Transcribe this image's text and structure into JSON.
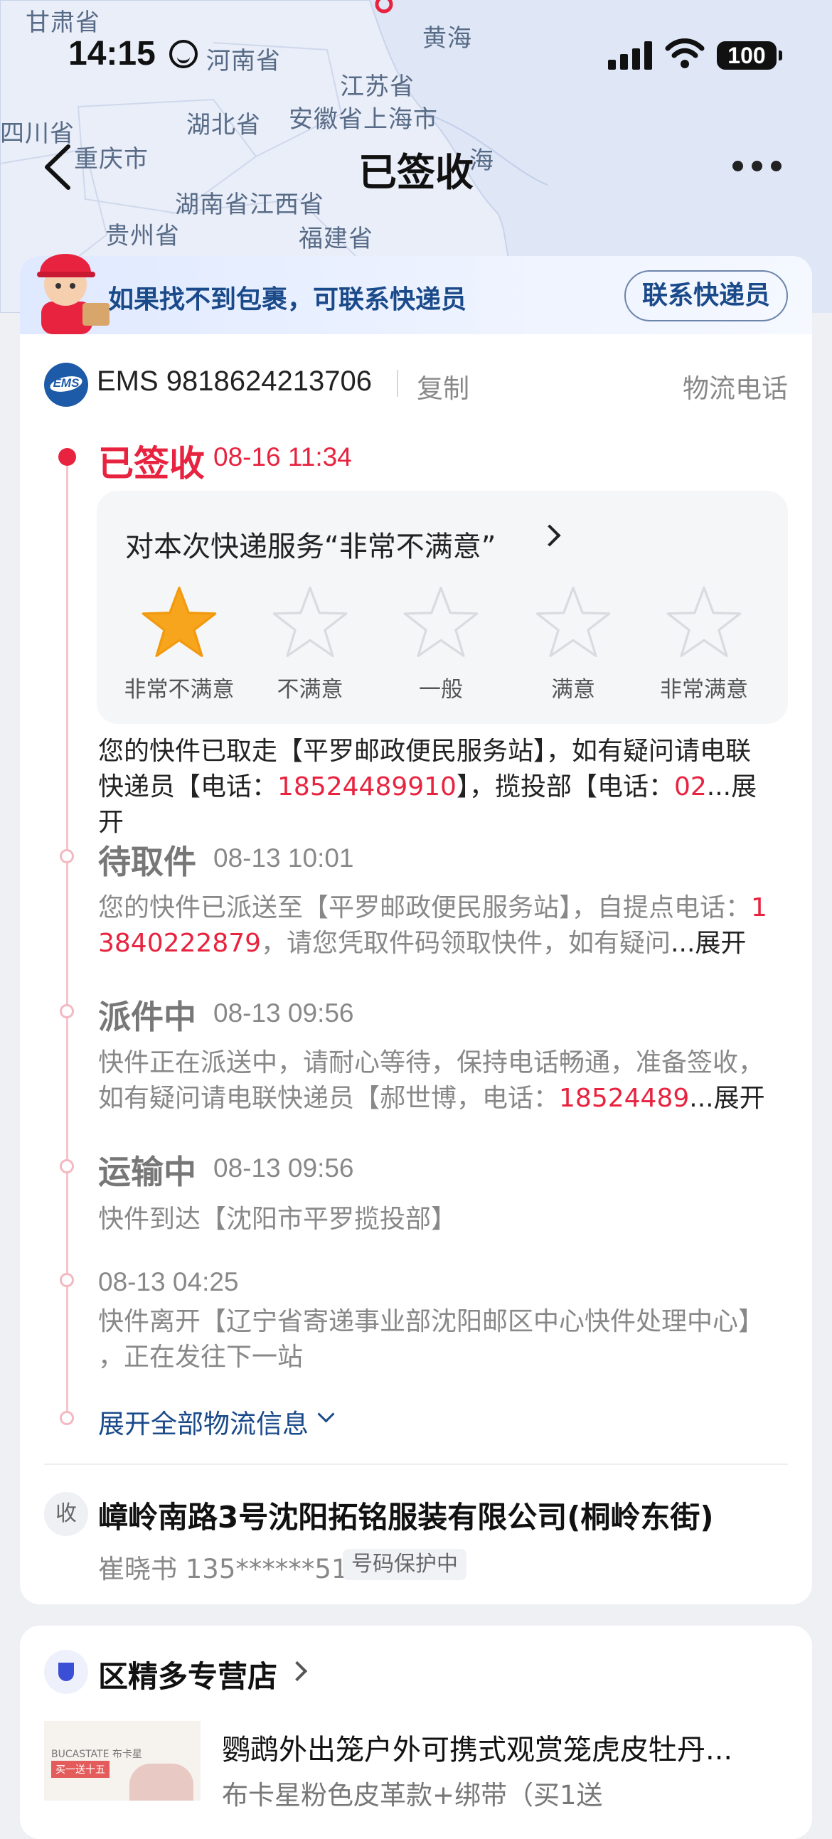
{
  "status_bar": {
    "time": "14:15",
    "battery": "100"
  },
  "map": {
    "labels": [
      {
        "text": "甘肃省"
      },
      {
        "text": "河南省"
      },
      {
        "text": "黄海"
      },
      {
        "text": "江苏省"
      },
      {
        "text": "四川省"
      },
      {
        "text": "湖北省"
      },
      {
        "text": "安徽省上海市"
      },
      {
        "text": "重庆市"
      },
      {
        "text": "海"
      },
      {
        "text": "湖南省江西省"
      },
      {
        "text": "贵州省"
      },
      {
        "text": "福建省"
      }
    ]
  },
  "nav": {
    "title": "已签收"
  },
  "banner": {
    "text": "如果找不到包裹，可联系快递员",
    "button": "联系快递员"
  },
  "shipment": {
    "carrier_logo": "EMS",
    "tracking": "EMS 9818624213706",
    "copy": "复制",
    "phone": "物流电话"
  },
  "timeline": {
    "current": {
      "status": "已签收",
      "time": "08-16 11:34",
      "desc_1": "您的快件已取走【平罗邮政便民服务站】，如有疑问请电联",
      "desc_2a": "快递员【电话：",
      "desc_2_phone": "18524489910",
      "desc_2b": "】，揽投部【电话：",
      "desc_2_phone2": "02",
      "desc_2_more": "...展开"
    },
    "rating": {
      "title": "对本次快递服务“非常不满意”",
      "options": [
        "非常不满意",
        "不满意",
        "一般",
        "满意",
        "非常满意"
      ],
      "selected": 1,
      "star_color": "#f7a51c"
    },
    "events": [
      {
        "status": "待取件",
        "time": "08-13 10:01",
        "line1a": "您的快件已派送至【平罗邮政便民服务站】，自提点电话：",
        "line1_phone": "1",
        "line2_phone": "3840222879",
        "line2b": "，请您凭取件码领取快件，如有疑问",
        "more": "...展开"
      },
      {
        "status": "派件中",
        "time": "08-13 09:56",
        "line1a": "快件正在派送中，请耐心等待，保持电话畅通，准备签收，",
        "line2a": "如有疑问请电联快递员【郝世博，电话：",
        "line2_phone": "18524489",
        "more": "...展开"
      },
      {
        "status": "运输中",
        "time": "08-13 09:56",
        "line1a": "快件到达【沈阳市平罗揽投部】"
      },
      {
        "time": "08-13 04:25",
        "line1a": "快件离开【辽宁省寄递事业部沈阳邮区中心快件处理中心】",
        "line2a": "，正在发往下一站"
      }
    ],
    "expand_all": "展开全部物流信息"
  },
  "recipient": {
    "badge": "收",
    "address": "嶂岭南路3号沈阳拓铭服装有限公司(桐岭东街)",
    "name_phone": "崔晓书 135******51",
    "protect": "号码保护中"
  },
  "shop": {
    "name": "区精多专营店",
    "thumb_brand": "BUCASTATE 布卡星",
    "thumb_promo": "买一送十五",
    "product_title": "鹦鹉外出笼户外可携式观赏笼虎皮牡丹...",
    "product_spec": "布卡星粉色皮革款+绑带（买1送"
  },
  "colors": {
    "accent_red": "#e8233f",
    "link_blue": "#1a4a8a",
    "timeline_pink": "#f6c4cc"
  }
}
